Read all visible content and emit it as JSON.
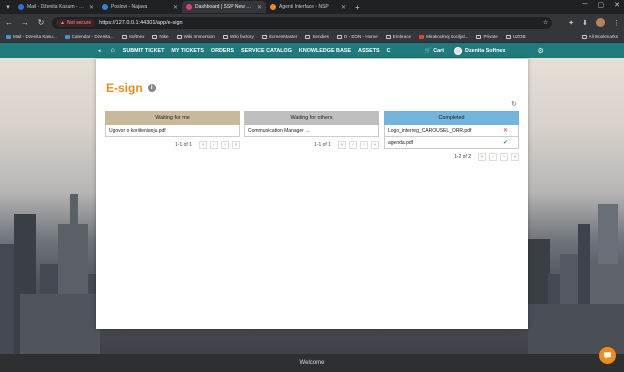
{
  "browser": {
    "tabs": [
      {
        "title": "Mail - Dženita Kasum - Outlo...",
        "color": "#2f6fd6",
        "active": false
      },
      {
        "title": "Poslovi - Najava",
        "color": "#3b7ddd",
        "active": false
      },
      {
        "title": "Dashboard | SSP New York Re...",
        "color": "#d93f7c",
        "active": true
      },
      {
        "title": "Agenti Interface - NSP",
        "color": "#f08a1c",
        "active": false
      }
    ],
    "new_tab": "+",
    "security_label": "Not secure",
    "url": "https://127.0.0.1:44301/app/e-sign",
    "bookmarks": [
      {
        "label": "Mail - Dzenita Kasu...",
        "style": "blue"
      },
      {
        "label": "Calendar - Dzenita...",
        "style": "blue"
      },
      {
        "label": "Softnex",
        "style": "folder"
      },
      {
        "label": "Nike",
        "style": "folder"
      },
      {
        "label": "Wiki Immersion",
        "style": "folder"
      },
      {
        "label": "Wiki factory",
        "style": "folder"
      },
      {
        "label": "ScreenMaster",
        "style": "folder"
      },
      {
        "label": "Sendies",
        "style": "folder"
      },
      {
        "label": "D - EON - Home",
        "style": "folder"
      },
      {
        "label": "Embrace",
        "style": "folder"
      },
      {
        "label": "Mirakoolnoj sociljal...",
        "style": "red"
      },
      {
        "label": "Private",
        "style": "folder"
      },
      {
        "label": "UZOB",
        "style": "folder"
      }
    ],
    "all_bookmarks": "All Bookmarks"
  },
  "app": {
    "nav_items": [
      "SUBMIT TICKET",
      "MY TICKETS",
      "ORDERS",
      "SERVICE CATALOG",
      "KNOWLEDGE BASE",
      "ASSETS",
      "C"
    ],
    "cart_label": "Cart",
    "user_name": "Dzenita Softnex",
    "accent": "#1f7a7c"
  },
  "esign": {
    "title": "E-sign",
    "columns": [
      {
        "header": "Waiting for me",
        "header_color": "#c9b99a",
        "rows": [
          {
            "name": "Ugovor o koriš...",
            "full": "Ugovor o koriitenianju.pdf",
            "mark": ""
          }
        ],
        "pager": "1-1 of 1"
      },
      {
        "header": "Waiting for others",
        "header_color": "#bfbfbf",
        "rows": [
          {
            "name": "Communication Manager ...",
            "mark": ""
          }
        ],
        "pager": "1-1 of 1"
      },
      {
        "header": "Completed",
        "header_color": "#74b3db",
        "rows": [
          {
            "name": "Logo_interreg_CAROUSEL_ORR.pdf",
            "mark": "✕",
            "mark_color": "#d9342b"
          },
          {
            "name": "agenda.pdf",
            "mark": "✔",
            "mark_color": "#3a9a3a"
          }
        ],
        "pager": "1-2 of 2"
      }
    ]
  },
  "footer_label": "Welcome"
}
